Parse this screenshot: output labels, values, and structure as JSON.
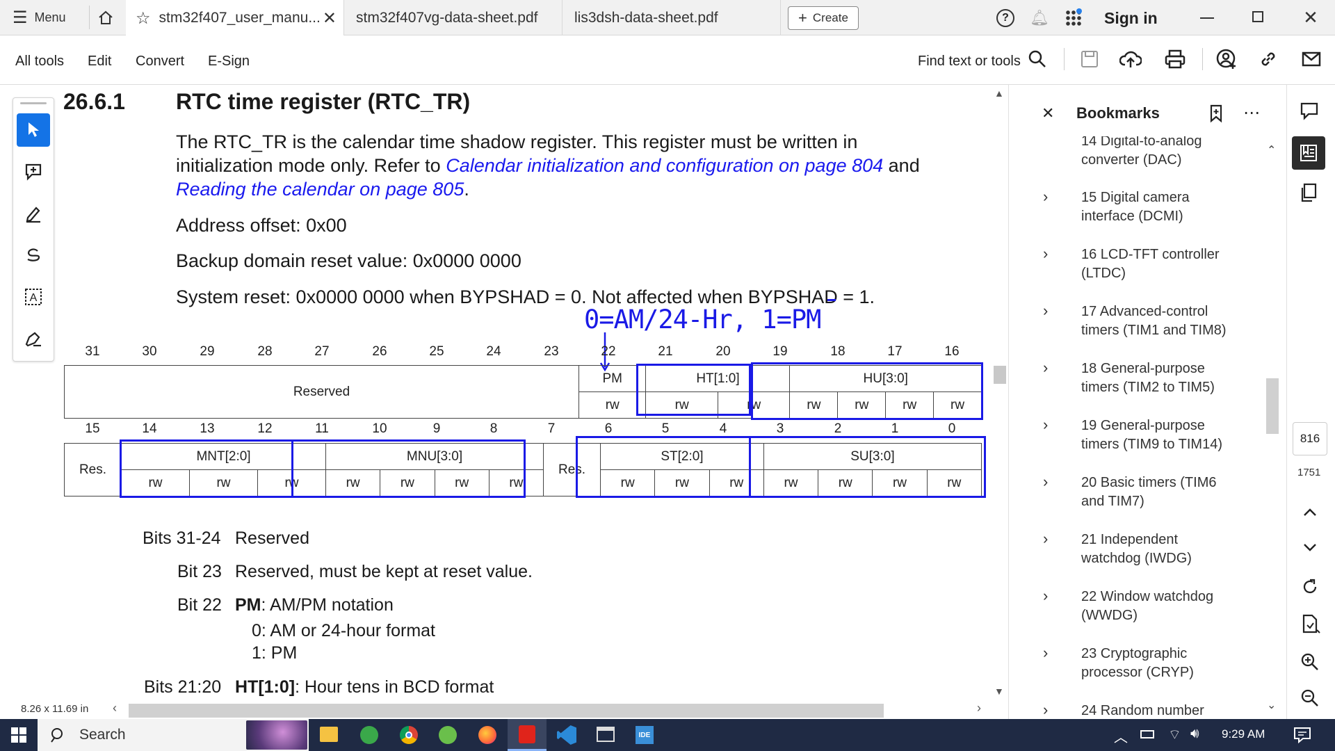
{
  "tabs": {
    "menu_label": "Menu",
    "tab1": "stm32f407_user_manu...",
    "tab2": "stm32f407vg-data-sheet.pdf",
    "tab3": "lis3dsh-data-sheet.pdf",
    "create": "Create",
    "sign_in": "Sign in"
  },
  "toolbar": {
    "all_tools": "All tools",
    "edit": "Edit",
    "convert": "Convert",
    "esign": "E-Sign",
    "find": "Find text or tools"
  },
  "doc": {
    "section_num": "26.6.1",
    "section_title": "RTC time register (RTC_TR)",
    "para1a": "The RTC_TR is the calendar time shadow register. This register must be written in",
    "para1b": "initialization mode only. Refer to ",
    "link1": "Calendar initialization and configuration on page 804",
    "para1c": " and",
    "link2": "Reading the calendar on page 805",
    "para1d": ".",
    "addr": "Address offset: 0x00",
    "backup": "Backup domain reset value: 0x0000 0000",
    "sysreset": "System reset: 0x0000 0000 when BYPSHAD = 0. Not affected when BYPSHAD = 1.",
    "annotation": "0=AM/24-Hr, 1=PM",
    "bits_hi": [
      "31",
      "30",
      "29",
      "28",
      "27",
      "26",
      "25",
      "24",
      "23",
      "22",
      "21",
      "20",
      "19",
      "18",
      "17",
      "16"
    ],
    "bits_lo": [
      "15",
      "14",
      "13",
      "12",
      "11",
      "10",
      "9",
      "8",
      "7",
      "6",
      "5",
      "4",
      "3",
      "2",
      "1",
      "0"
    ],
    "reserved": "Reserved",
    "pm": "PM",
    "ht": "HT[1:0]",
    "hu": "HU[3:0]",
    "rw": "rw",
    "res": "Res.",
    "mnt": "MNT[2:0]",
    "mnu": "MNU[3:0]",
    "st": "ST[2:0]",
    "su": "SU[3:0]",
    "d1_bits": "Bits 31-24",
    "d1_text": "Reserved",
    "d2_bits": "Bit 23",
    "d2_text": "Reserved, must be kept at reset value.",
    "d3_bits": "Bit 22",
    "d3_bold": "PM",
    "d3_text": ": AM/PM notation",
    "d3_o0": "0: AM or 24-hour format",
    "d3_o1": "1: PM",
    "d4_bits": "Bits 21:20",
    "d4_bold": "HT[1:0]",
    "d4_text": ": Hour tens in BCD format"
  },
  "status": {
    "page_size": "8.26 x 11.69 in",
    "page_num": "816",
    "page_total": "1751"
  },
  "bookmarks": {
    "title": "Bookmarks",
    "items": [
      "14 Digital-to-analog converter (DAC)",
      "15 Digital camera interface (DCMI)",
      "16 LCD-TFT controller (LTDC)",
      "17 Advanced-control timers (TIM1 and TIM8)",
      "18 General-purpose timers (TIM2 to TIM5)",
      "19 General-purpose timers (TIM9 to TIM14)",
      "20 Basic timers (TIM6 and TIM7)",
      "21 Independent watchdog (IWDG)",
      "22 Window watchdog (WWDG)",
      "23 Cryptographic processor (CRYP)",
      "24 Random number"
    ]
  },
  "taskbar": {
    "search": "Search",
    "time": "9:29 AM"
  },
  "colors": {
    "annotation_blue": "#1a1ae6",
    "link_blue": "#1a1aee",
    "taskbar": "#1f2a44"
  }
}
